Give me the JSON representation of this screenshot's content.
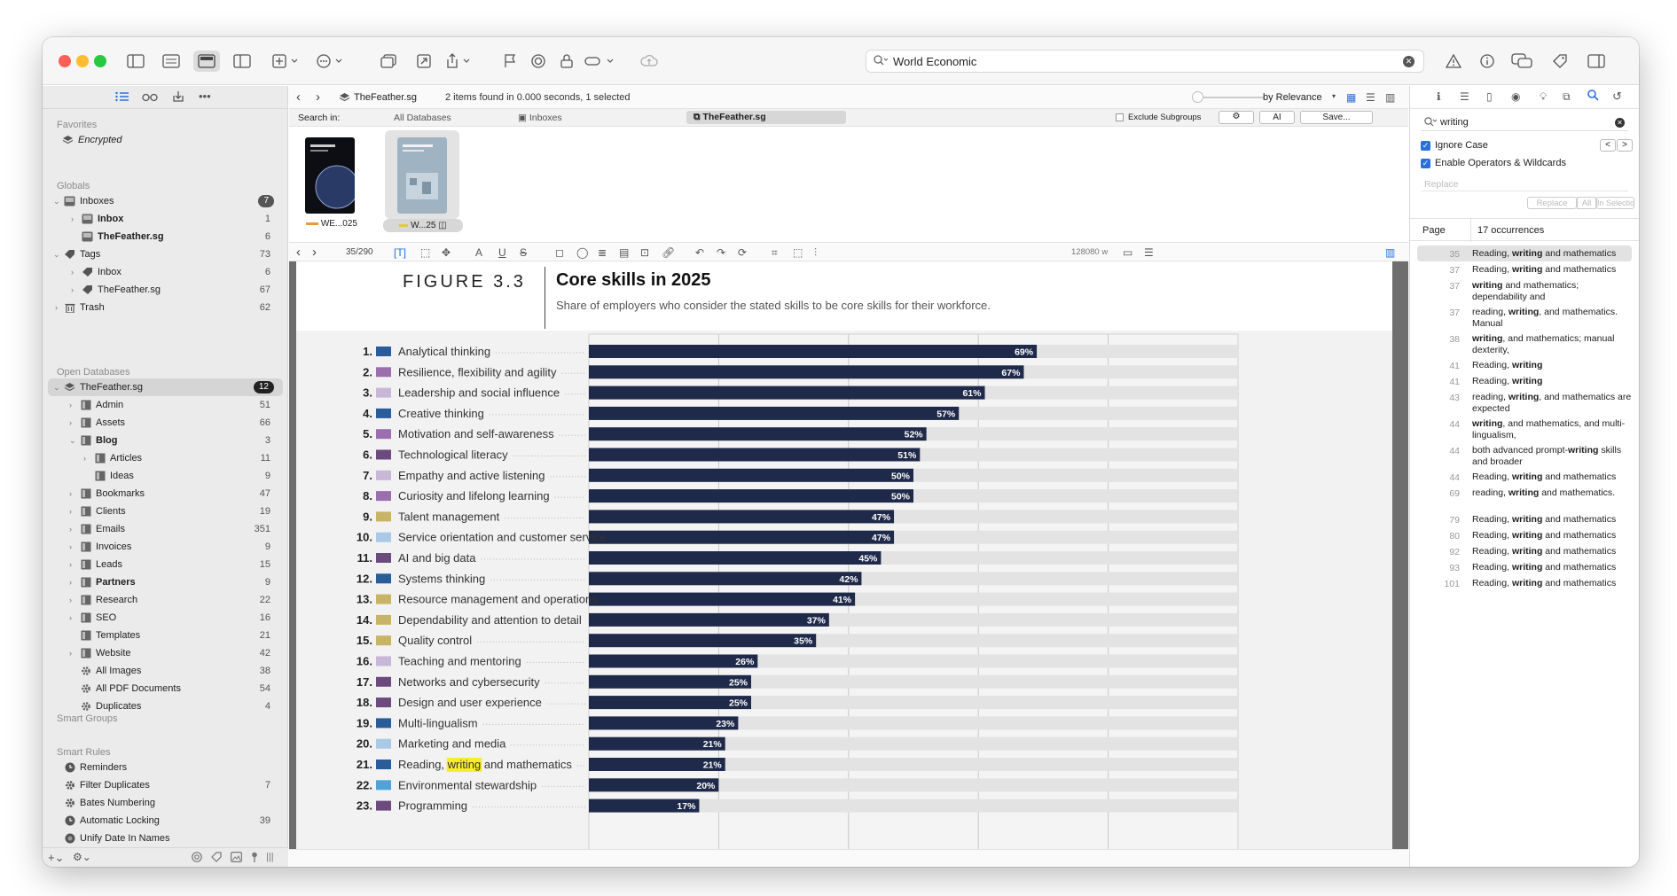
{
  "toolbar": {
    "search_value": "World Economic"
  },
  "sidebar": {
    "sections": {
      "favorites": "Favorites",
      "globals": "Globals",
      "open_databases": "Open Databases",
      "smart_groups": "Smart Groups",
      "smart_rules": "Smart Rules"
    },
    "favorites": [
      {
        "label": "Encrypted"
      }
    ],
    "globals": [
      {
        "label": "Inboxes",
        "badge": "7"
      },
      {
        "label": "Inbox",
        "count": "1"
      },
      {
        "label": "TheFeather.sg",
        "count": "6"
      },
      {
        "label": "Tags",
        "count": "73"
      },
      {
        "label": "Inbox",
        "count": "6"
      },
      {
        "label": "TheFeather.sg",
        "count": "67"
      },
      {
        "label": "Trash",
        "count": "62"
      }
    ],
    "database": {
      "label": "TheFeather.sg",
      "badge": "12"
    },
    "db_items": [
      {
        "label": "Admin",
        "count": "51"
      },
      {
        "label": "Assets",
        "count": "66"
      },
      {
        "label": "Blog",
        "count": "3"
      },
      {
        "label": "Articles",
        "count": "11"
      },
      {
        "label": "Ideas",
        "count": "9"
      },
      {
        "label": "Bookmarks",
        "count": "47"
      },
      {
        "label": "Clients",
        "count": "19"
      },
      {
        "label": "Emails",
        "count": "351"
      },
      {
        "label": "Invoices",
        "count": "9"
      },
      {
        "label": "Leads",
        "count": "15"
      },
      {
        "label": "Partners",
        "count": "9"
      },
      {
        "label": "Research",
        "count": "22"
      },
      {
        "label": "SEO",
        "count": "16"
      },
      {
        "label": "Templates",
        "count": "21"
      },
      {
        "label": "Website",
        "count": "42"
      },
      {
        "label": "All Images",
        "count": "38"
      },
      {
        "label": "All PDF Documents",
        "count": "54"
      },
      {
        "label": "Duplicates",
        "count": "4"
      }
    ],
    "smart_rules": [
      {
        "label": "Reminders",
        "count": ""
      },
      {
        "label": "Filter Duplicates",
        "count": "7"
      },
      {
        "label": "Bates Numbering",
        "count": ""
      },
      {
        "label": "Automatic Locking",
        "count": "39"
      },
      {
        "label": "Unify Date In Names",
        "count": ""
      }
    ]
  },
  "browser": {
    "db_name": "TheFeather.sg",
    "status": "2 items found in 0.000 seconds, 1 selected",
    "sort": "by Relevance",
    "search_in": "Search in:",
    "scopes": [
      "All Databases",
      "Inboxes",
      "TheFeather.sg"
    ],
    "exclude_subgroups": "Exclude Subgroups",
    "ai_button": "AI",
    "save_button": "Save...",
    "thumbs": [
      {
        "label": "WE...025"
      },
      {
        "label": "W...25"
      }
    ]
  },
  "viewer": {
    "page_indicator": "35/290",
    "word_count": "128080 w"
  },
  "figure": {
    "label": "FIGURE 3.3",
    "title": "Core skills in 2025",
    "subtitle": "Share of employers who consider the stated skills to be core skills for their workforce.",
    "highlight_word": "writing"
  },
  "chart_data": {
    "type": "bar",
    "orientation": "horizontal",
    "xlim": [
      0,
      100
    ],
    "categories": [
      "Analytical thinking",
      "Resilience, flexibility and agility",
      "Leadership and social influence",
      "Creative thinking",
      "Motivation and self-awareness",
      "Technological literacy",
      "Empathy and active listening",
      "Curiosity and lifelong learning",
      "Talent management",
      "Service orientation and customer service",
      "AI and big data",
      "Systems thinking",
      "Resource management and operations",
      "Dependability and attention to detail",
      "Quality control",
      "Teaching and mentoring",
      "Networks and cybersecurity",
      "Design and user experience",
      "Multi-lingualism",
      "Marketing and media",
      "Reading, writing and mathematics",
      "Environmental stewardship",
      "Programming"
    ],
    "values": [
      69,
      67,
      61,
      57,
      52,
      51,
      50,
      50,
      47,
      47,
      45,
      42,
      41,
      37,
      35,
      26,
      25,
      25,
      23,
      21,
      21,
      20,
      17
    ],
    "swatch_colors": [
      "#2a5c9a",
      "#9b6fae",
      "#c9b7d8",
      "#2a5c9a",
      "#9b6fae",
      "#6b4a7e",
      "#c9b7d8",
      "#9b6fae",
      "#c8b467",
      "#a9c9e6",
      "#6b4a7e",
      "#2a5c9a",
      "#c8b467",
      "#c8b467",
      "#c8b467",
      "#c9b7d8",
      "#6b4a7e",
      "#6b4a7e",
      "#2a5c9a",
      "#a9c9e6",
      "#2a5c9a",
      "#4fa3d9",
      "#6b4a7e"
    ],
    "bar_color": "#1f2a4a",
    "track_color": "#e3e3e3"
  },
  "find_panel": {
    "query": "writing",
    "ignore_case": "Ignore Case",
    "enable_operators": "Enable Operators & Wildcards",
    "replace_placeholder": "Replace",
    "replace_btn": "Replace",
    "all_btn": "All",
    "in_selection_btn": "In Selection",
    "col_page": "Page",
    "occurrences": "17 occurrences",
    "results": [
      {
        "page": "35",
        "pre": "Reading, ",
        "hit": "writing",
        "post": " and mathematics"
      },
      {
        "page": "37",
        "pre": "Reading, ",
        "hit": "writing",
        "post": " and mathematics"
      },
      {
        "page": "37",
        "pre": "",
        "hit": "writing",
        "post": " and mathematics; dependability and"
      },
      {
        "page": "37",
        "pre": "reading, ",
        "hit": "writing",
        "post": ", and mathematics. Manual"
      },
      {
        "page": "38",
        "pre": "",
        "hit": "writing",
        "post": ", and mathematics; manual dexterity,"
      },
      {
        "page": "41",
        "pre": "Reading, ",
        "hit": "writing",
        "post": ""
      },
      {
        "page": "41",
        "pre": "Reading, ",
        "hit": "writing",
        "post": ""
      },
      {
        "page": "43",
        "pre": "reading, ",
        "hit": "writing",
        "post": ", and mathematics are expected"
      },
      {
        "page": "44",
        "pre": "",
        "hit": "writing",
        "post": ", and mathematics, and multi-lingualism,"
      },
      {
        "page": "44",
        "pre": "both advanced prompt-",
        "hit": "writing",
        "post": " skills and broader"
      },
      {
        "page": "44",
        "pre": "Reading, ",
        "hit": "writing",
        "post": " and mathematics"
      },
      {
        "page": "69",
        "pre": "reading, ",
        "hit": "writing",
        "post": " and mathematics."
      },
      {
        "page": "79",
        "pre": "Reading, ",
        "hit": "writing",
        "post": " and mathematics"
      },
      {
        "page": "80",
        "pre": "Reading, ",
        "hit": "writing",
        "post": " and mathematics"
      },
      {
        "page": "92",
        "pre": "Reading, ",
        "hit": "writing",
        "post": " and mathematics"
      },
      {
        "page": "93",
        "pre": "Reading, ",
        "hit": "writing",
        "post": " and mathematics"
      },
      {
        "page": "101",
        "pre": "Reading, ",
        "hit": "writing",
        "post": " and mathematics"
      }
    ]
  }
}
